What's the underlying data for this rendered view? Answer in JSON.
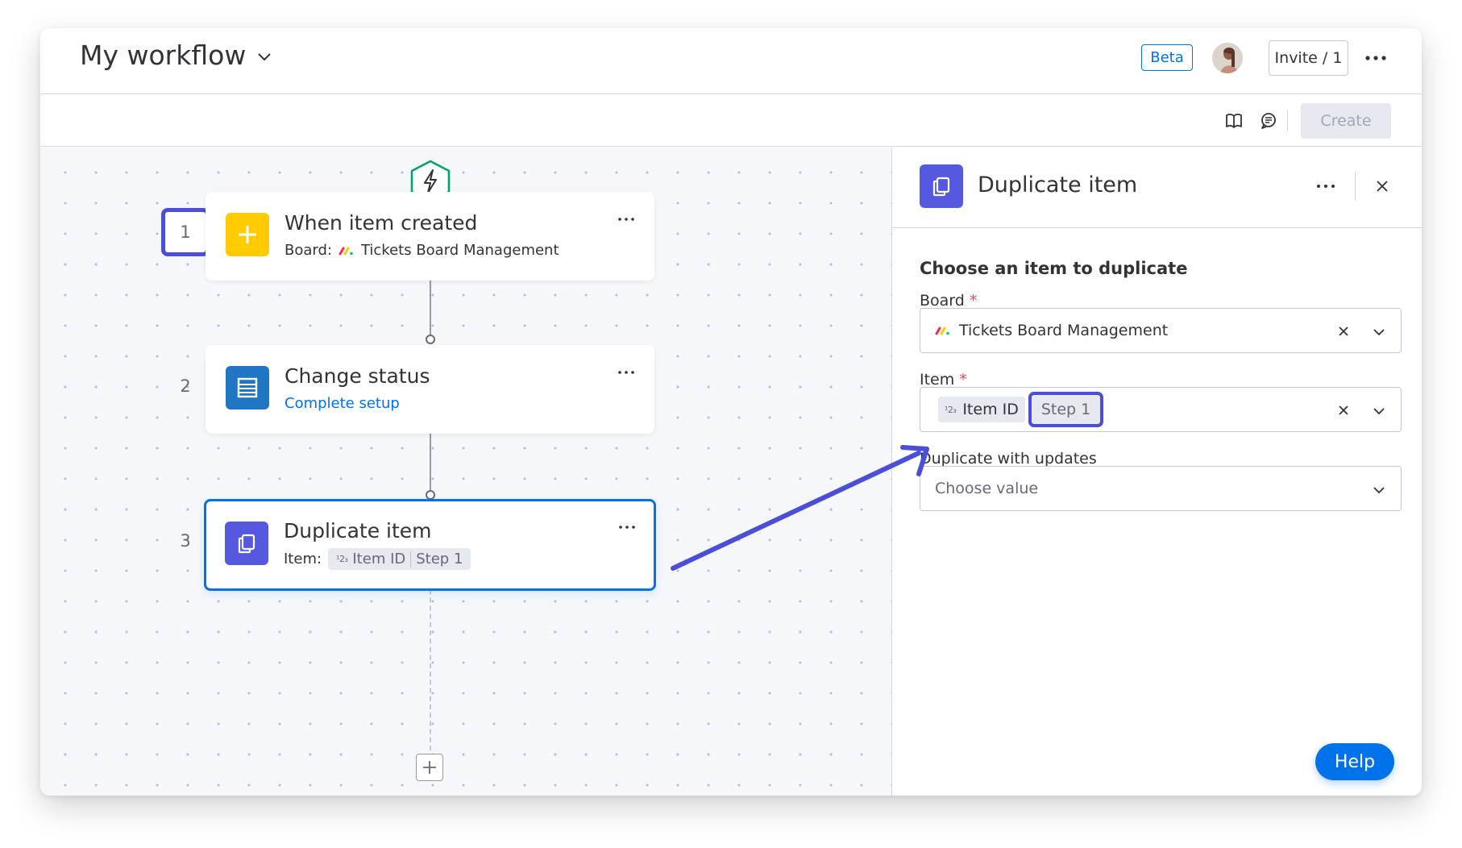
{
  "header": {
    "title": "My workflow",
    "beta_label": "Beta",
    "invite_label": "Invite / 1"
  },
  "toolbar": {
    "create_label": "Create"
  },
  "workflow": {
    "steps": [
      {
        "number": "1",
        "title": "When item created",
        "sub_label": "Board:",
        "board_name": "Tickets Board Management",
        "icon": "plus-icon",
        "icon_color": "#ffcb00"
      },
      {
        "number": "2",
        "title": "Change status",
        "link_text": "Complete setup",
        "icon": "status-column-icon",
        "icon_color": "#1f76c2"
      },
      {
        "number": "3",
        "title": "Duplicate item",
        "sub_label": "Item:",
        "chip_field": "Item ID",
        "chip_step": "Step 1",
        "icon": "duplicate-icon",
        "icon_color": "#5559df"
      }
    ]
  },
  "panel": {
    "title": "Duplicate item",
    "section_title": "Choose an item to duplicate",
    "board_label": "Board",
    "board_value": "Tickets Board Management",
    "item_label": "Item",
    "item_field": "Item ID",
    "item_step": "Step 1",
    "updates_label": "Duplicate with updates",
    "updates_placeholder": "Choose value",
    "required_mark": "*"
  },
  "help_label": "Help",
  "colors": {
    "primary": "#0073ea",
    "annotation": "#4b4ed6",
    "trigger_green": "#00a36c",
    "required": "#e2445c"
  }
}
